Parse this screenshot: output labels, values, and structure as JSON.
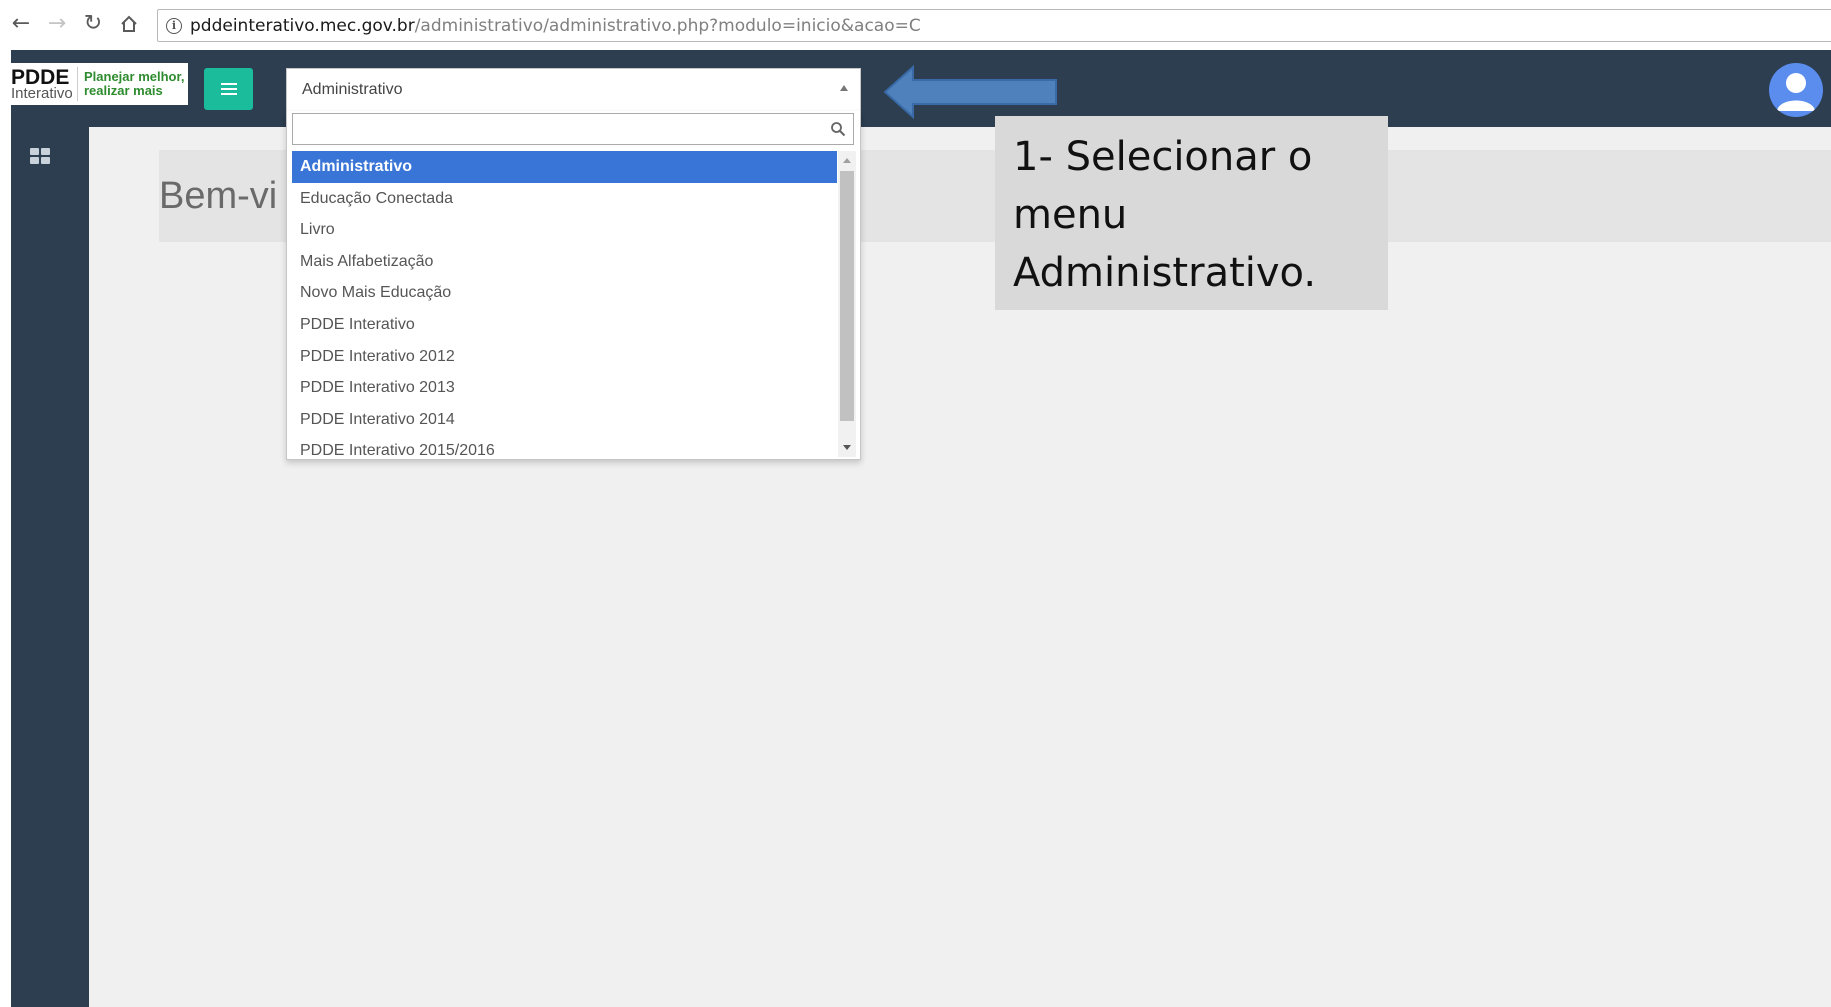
{
  "browser": {
    "url_host": "pddeinterativo.mec.gov.br",
    "url_path": "/administrativo/administrativo.php?modulo=inicio&acao=C"
  },
  "header": {
    "logo_main": "PDDE",
    "logo_sub": "Interativo",
    "slogan_line1": "Planejar melhor,",
    "slogan_line2": "realizar mais"
  },
  "module_select": {
    "selected_value": "Administrativo",
    "search_value": "",
    "options": [
      "Administrativo",
      "Educação Conectada",
      "Livro",
      "Mais Alfabetização",
      "Novo Mais Educação",
      "PDDE Interativo",
      "PDDE Interativo 2012",
      "PDDE Interativo 2013",
      "PDDE Interativo 2014",
      "PDDE Interativo 2015/2016"
    ]
  },
  "main": {
    "welcome_text": "Bem-vi"
  },
  "annotation": {
    "callout_text": "1- Selecionar o menu Administrativo."
  },
  "colors": {
    "header_bg": "#2c3e50",
    "menu_button": "#1abc9c",
    "selected_option": "#3875d7",
    "annotation_arrow": "#4f81bd"
  },
  "icons": {
    "back": "arrow-left-icon",
    "forward": "arrow-right-icon",
    "reload": "reload-icon",
    "home": "home-icon",
    "info": "info-icon",
    "menu": "hamburger-icon",
    "dashboard": "dashboard-icon",
    "search": "search-icon",
    "user": "user-avatar-icon"
  }
}
